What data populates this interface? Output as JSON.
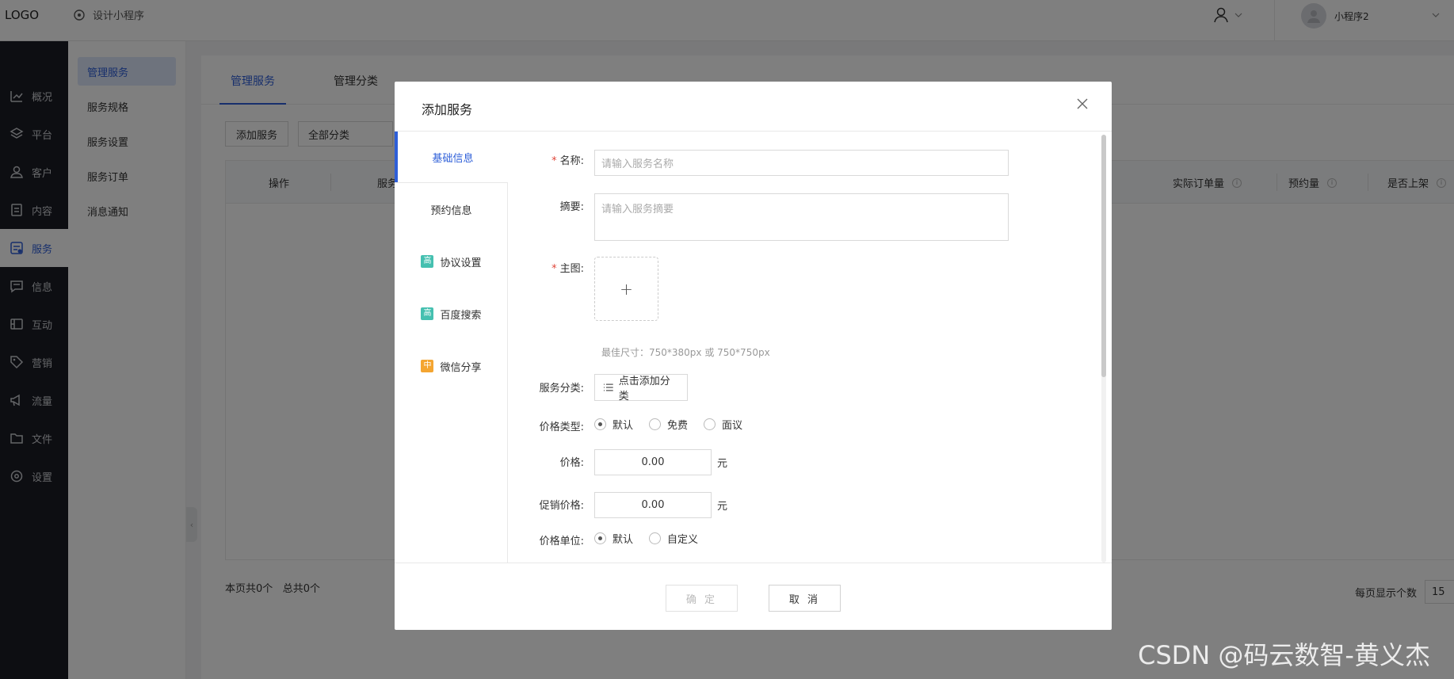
{
  "header": {
    "logo": "LOGO",
    "app_name": "设计小程序",
    "account_name": "小程序2"
  },
  "dark_nav": [
    {
      "label": "概况",
      "icon": "chart-icon"
    },
    {
      "label": "平台",
      "icon": "layers-icon"
    },
    {
      "label": "客户",
      "icon": "user-icon"
    },
    {
      "label": "内容",
      "icon": "document-icon"
    },
    {
      "label": "服务",
      "icon": "service-icon",
      "active": true
    },
    {
      "label": "信息",
      "icon": "message-icon"
    },
    {
      "label": "互动",
      "icon": "interact-icon"
    },
    {
      "label": "营销",
      "icon": "tag-icon"
    },
    {
      "label": "流量",
      "icon": "megaphone-icon"
    },
    {
      "label": "文件",
      "icon": "folder-icon"
    },
    {
      "label": "设置",
      "icon": "gear-icon"
    }
  ],
  "sub_nav": [
    "管理服务",
    "服务规格",
    "服务设置",
    "服务订单",
    "消息通知"
  ],
  "main": {
    "tabs": [
      "管理服务",
      "管理分类"
    ],
    "add_button": "添加服务",
    "category_select": "全部分类",
    "table_headers": [
      "操作",
      "服务",
      "实际订单量",
      "预约量",
      "是否上架"
    ],
    "page_count": "本页共0个",
    "total_count": "总共0个",
    "per_page_label": "每页显示个数",
    "per_page_value": "15"
  },
  "modal": {
    "title": "添加服务",
    "side_tabs": [
      {
        "label": "基础信息",
        "active": true
      },
      {
        "label": "预约信息"
      },
      {
        "label": "协议设置",
        "badge": "高",
        "badge_color": "#45c0b0"
      },
      {
        "label": "百度搜索",
        "badge": "高",
        "badge_color": "#45c0b0"
      },
      {
        "label": "微信分享",
        "badge": "中",
        "badge_color": "#f4a531"
      }
    ],
    "form": {
      "name_label": "名称:",
      "name_placeholder": "请输入服务名称",
      "summary_label": "摘要:",
      "summary_placeholder": "请输入服务摘要",
      "image_label": "主图:",
      "upload_plus": "+",
      "image_hint": "最佳尺寸：750*380px 或 750*750px",
      "category_label": "服务分类:",
      "category_button": "点击添加分类",
      "price_type_label": "价格类型:",
      "price_type_options": [
        "默认",
        "免费",
        "面议"
      ],
      "price_type_selected": "默认",
      "price_label": "价格:",
      "price_value": "0.00",
      "promo_label": "促销价格:",
      "promo_value": "0.00",
      "currency_unit": "元",
      "price_unit_label": "价格单位:",
      "price_unit_options": [
        "默认",
        "自定义"
      ],
      "price_unit_selected": "默认"
    },
    "confirm_button": "确 定",
    "cancel_button": "取 消"
  },
  "watermark": "CSDN @码云数智-黄义杰",
  "colors": {
    "accent": "#2e5fd8",
    "sidebar": "#1b1d24",
    "required": "#e0463a"
  }
}
